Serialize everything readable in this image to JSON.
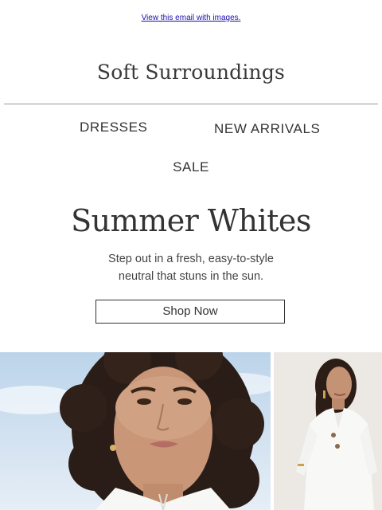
{
  "header": {
    "view_link": "View this email with images.",
    "brand": "Soft Surroundings"
  },
  "nav": {
    "dresses": "DRESSES",
    "new_arrivals": "NEW ARRIVALS",
    "sale": "SALE"
  },
  "hero": {
    "headline": "Summer Whites",
    "subtext_line1": "Step out in a fresh, easy-to-style",
    "subtext_line2": "neutral that stuns in the sun.",
    "cta_label": "Shop Now"
  },
  "colors": {
    "link": "#1a0dab",
    "text": "#333333",
    "sky": "#cfe0ef"
  },
  "images": {
    "left": "woman-curly-hair-white-top-photo",
    "right": "woman-white-tunic-dress-photo"
  }
}
